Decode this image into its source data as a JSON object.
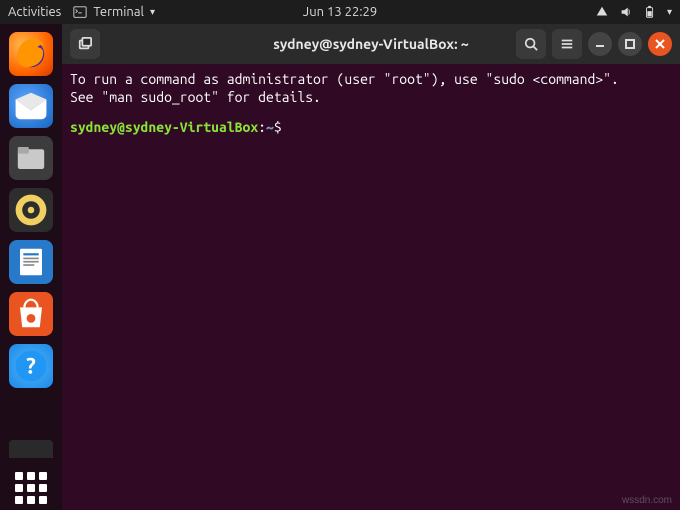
{
  "topbar": {
    "activities": "Activities",
    "app": "Terminal",
    "datetime": "Jun 13  22:29"
  },
  "dock": {
    "items": [
      "Firefox",
      "Thunderbird",
      "Files",
      "Rhythmbox",
      "LibreOffice Writer",
      "Ubuntu Software",
      "Help"
    ]
  },
  "window": {
    "title": "sydney@sydney-VirtualBox: ~"
  },
  "terminal": {
    "message": "To run a command as administrator (user \"root\"), use \"sudo <command>\".\nSee \"man sudo_root\" for details.",
    "prompt_user": "sydney@sydney-VirtualBox",
    "prompt_colon": ":",
    "prompt_path": "~",
    "prompt_symbol": "$ "
  },
  "watermark": "wssdn.com"
}
